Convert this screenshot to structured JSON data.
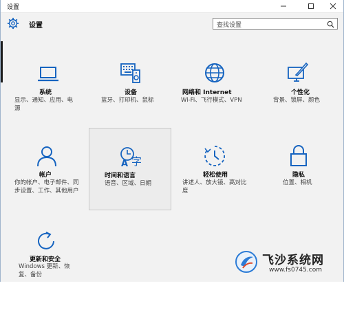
{
  "window": {
    "title": "设置",
    "minimize_icon": "minimize-icon",
    "maximize_icon": "maximize-icon",
    "close_icon": "close-icon"
  },
  "header": {
    "title": "设置",
    "search_placeholder": "查找设置"
  },
  "colors": {
    "accent": "#1664c0",
    "background": "#f2f2f2"
  },
  "tiles": [
    {
      "label": "系统",
      "desc": "显示、通知、应用、电源",
      "icon": "laptop-icon"
    },
    {
      "label": "设备",
      "desc": "蓝牙、打印机、鼠标",
      "icon": "keyboard-speaker-icon"
    },
    {
      "label": "网络和 Internet",
      "desc": "Wi-Fi、飞行模式、VPN",
      "icon": "globe-icon"
    },
    {
      "label": "个性化",
      "desc": "背景、锁屏、颜色",
      "icon": "paint-monitor-icon"
    },
    {
      "label": "帐户",
      "desc": "你的帐户、电子邮件、同步设置、工作、其他用户",
      "icon": "person-icon"
    },
    {
      "label": "时间和语言",
      "desc": "语音、区域、日期",
      "icon": "time-language-icon"
    },
    {
      "label": "轻松使用",
      "desc": "讲述人、放大镜、高对比度",
      "icon": "ease-of-access-icon"
    },
    {
      "label": "隐私",
      "desc": "位置、相机",
      "icon": "lock-icon"
    },
    {
      "label": "更新和安全",
      "desc": "Windows 更新、恢复、备份",
      "icon": "update-icon"
    }
  ],
  "watermark": {
    "title": "飞沙系统网",
    "url": "www.fs0745.com"
  }
}
